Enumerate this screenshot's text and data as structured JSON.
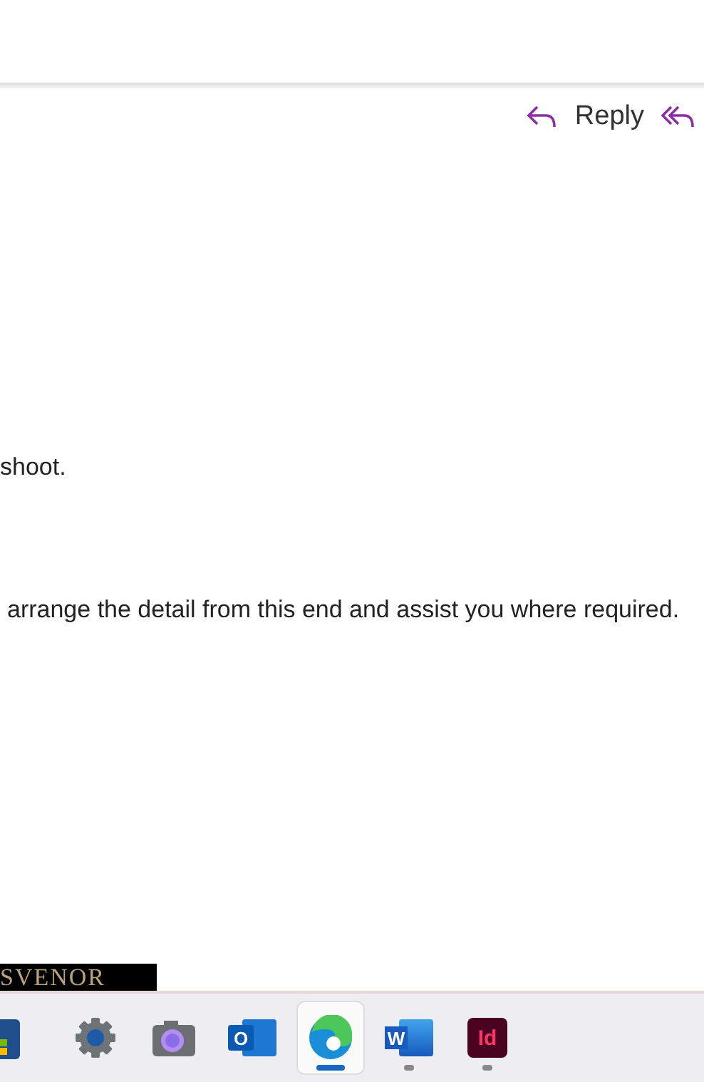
{
  "toolbar": {
    "reply": {
      "label": "Reply"
    }
  },
  "message": {
    "lines": [
      "shoot.",
      "arrange the detail from this end and assist you where required."
    ],
    "signature_logo": "SVENOR"
  },
  "taskbar": {
    "apps": [
      {
        "kind": "store",
        "selected": false,
        "running": false
      },
      {
        "kind": "settings",
        "selected": false,
        "running": false
      },
      {
        "kind": "camera",
        "selected": false,
        "running": false
      },
      {
        "kind": "outlook",
        "letter": "O",
        "selected": false,
        "running": false
      },
      {
        "kind": "edge",
        "selected": true,
        "running": true
      },
      {
        "kind": "word",
        "letter": "W",
        "selected": false,
        "running": true
      },
      {
        "kind": "indesign",
        "letter": "Id",
        "selected": false,
        "running": true
      }
    ]
  }
}
